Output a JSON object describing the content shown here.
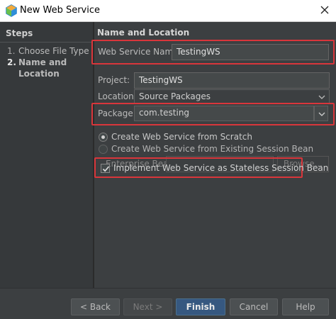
{
  "window": {
    "title": "New Web Service",
    "icons": {
      "app": "netbeans-cube-icon",
      "close": "close-icon"
    }
  },
  "steps": {
    "title": "Steps",
    "items": [
      {
        "number": "1.",
        "label": "Choose File Type"
      },
      {
        "number": "2.",
        "label": "Name and Location"
      }
    ]
  },
  "main": {
    "section_title": "Name and Location",
    "service_name": {
      "label": "Web Service Name:",
      "value": "TestingWS"
    },
    "project": {
      "label": "Project:",
      "value": "TestingWS"
    },
    "location": {
      "label": "Location:",
      "value": "Source Packages"
    },
    "package": {
      "label": "Package:",
      "value": "com.testing"
    },
    "create_options": [
      {
        "label": "Create Web Service from Scratch",
        "selected": true
      },
      {
        "label": "Create Web Service from Existing Session Bean",
        "selected": false
      }
    ],
    "enterprise_bean": {
      "label": "Enterprise Bean:",
      "value": "",
      "browse_label": "Browse..."
    },
    "stateless_checkbox": {
      "label": "Implement Web Service as Stateless Session Bean",
      "checked": true
    }
  },
  "footer": {
    "back": "< Back",
    "next": "Next >",
    "finish": "Finish",
    "cancel": "Cancel",
    "help": "Help"
  },
  "colors": {
    "background": "#3c3f41",
    "steps_panel": "#36393b",
    "highlight": "#d9363b",
    "primary_button": "#365880"
  }
}
